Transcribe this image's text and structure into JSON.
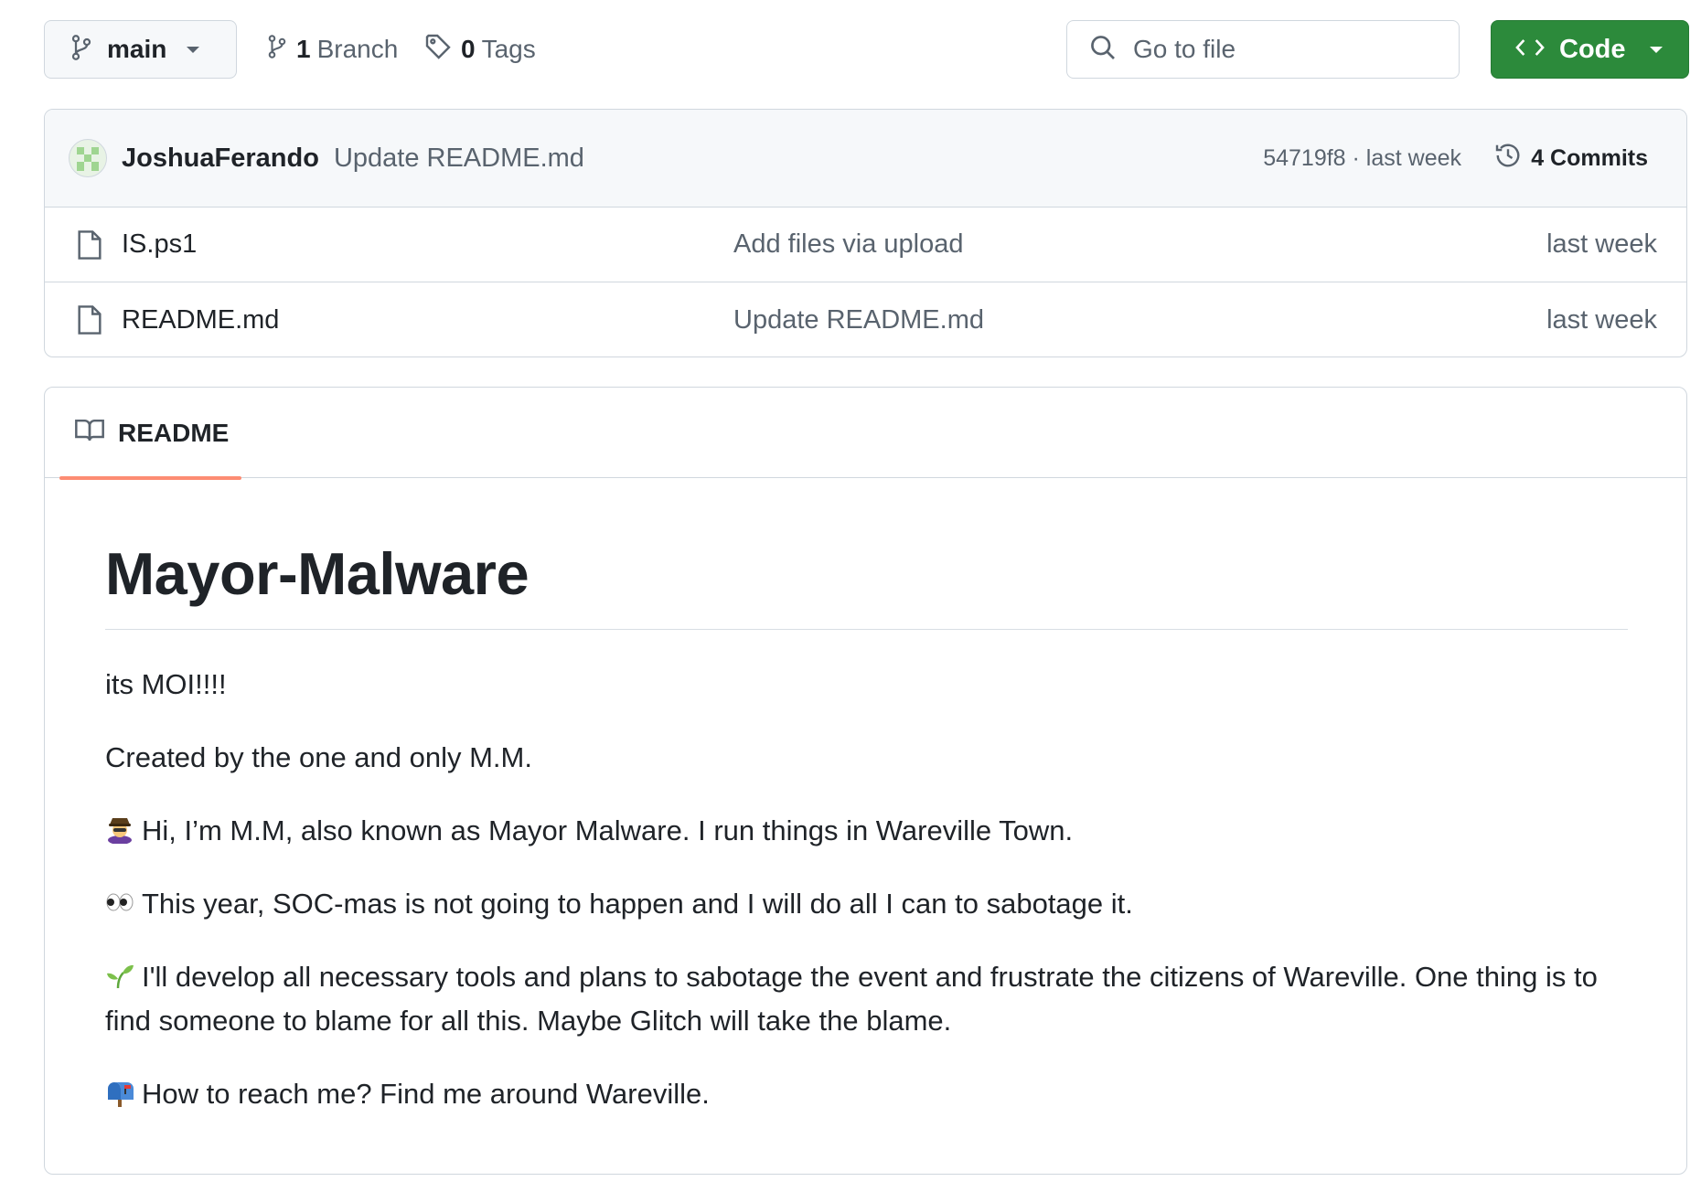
{
  "toolbar": {
    "branch_name": "main",
    "branch_count": "1",
    "branch_label": "Branch",
    "tag_count": "0",
    "tag_label": "Tags",
    "search_placeholder": "Go to file",
    "code_label": "Code"
  },
  "latest_commit": {
    "author": "JoshuaFerando",
    "message": "Update README.md",
    "sha_and_time": "54719f8 · last week",
    "commits_label": "4 Commits"
  },
  "files": [
    {
      "name": "IS.ps1",
      "message": "Add files via upload",
      "date": "last week"
    },
    {
      "name": "README.md",
      "message": "Update README.md",
      "date": "last week"
    }
  ],
  "readme": {
    "tab_label": "README",
    "title": "Mayor-Malware",
    "paragraphs": [
      "its MOI!!!!",
      "Created by the one and only M.M.",
      "Hi, I’m M.M, also known as Mayor Malware. I run things in Wareville Town.",
      "This year, SOC-mas is not going to happen and I will do all I can to sabotage it.",
      "I'll develop all necessary tools and plans to sabotage the event and frustrate the citizens of Wareville. One thing is to find someone to blame for all this. Maybe Glitch will take the blame.",
      "How to reach me? Find me around Wareville."
    ],
    "emoji_names": [
      "detective-icon",
      "eyes-icon",
      "seedling-icon",
      "mailbox-icon"
    ]
  },
  "colors": {
    "code_button": "#2c8a3b",
    "tab_underline": "#fd8c73",
    "muted_text": "#59636e",
    "border": "#d0d7de"
  }
}
